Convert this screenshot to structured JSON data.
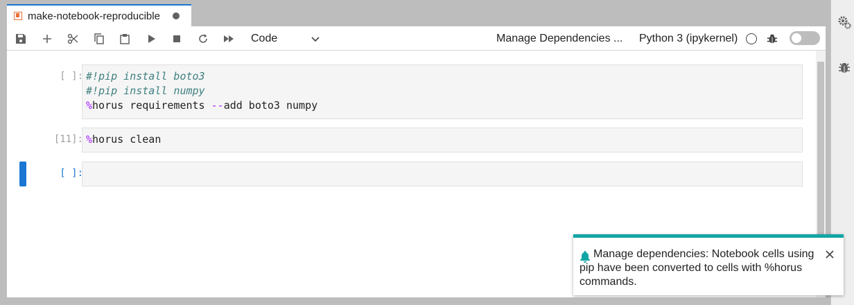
{
  "tab": {
    "title": "make-notebook-reproducible"
  },
  "toolbar": {
    "cell_type": "Code",
    "manage_label": "Manage Dependencies ...",
    "kernel_name": "Python 3 (ipykernel)"
  },
  "cells": [
    {
      "prompt": "[ ]:",
      "lines": [
        "#!pip install boto3",
        "#!pip install numpy",
        "%horus requirements --add boto3 numpy"
      ]
    },
    {
      "prompt": "[11]:",
      "lines": [
        "%horus clean"
      ]
    },
    {
      "prompt": "[ ]:",
      "lines": [
        ""
      ]
    }
  ],
  "code": {
    "c0l0": "#!pip install boto3",
    "c0l1": "#!pip install numpy",
    "c0l2_mag": "%",
    "c0l2_a": "horus requirements ",
    "c0l2_op": "--",
    "c0l2_b": "add boto3 numpy",
    "c1_mag": "%",
    "c1_rest": "horus clean"
  },
  "notification": {
    "message": "Manage dependencies: Notebook cells using pip have been converted to cells with %horus commands."
  },
  "colors": {
    "accent": "#1976d2",
    "toast_border": "#12a5a5",
    "magic": "#aa22ff",
    "comment": "#408080"
  },
  "icons": [
    "notebook-icon",
    "save-icon",
    "add-icon",
    "cut-icon",
    "copy-icon",
    "paste-icon",
    "run-icon",
    "stop-icon",
    "restart-icon",
    "fast-forward-icon",
    "chevron-down-icon",
    "kernel-status-icon",
    "bug-icon",
    "gears-icon",
    "bell-icon",
    "close-icon"
  ]
}
